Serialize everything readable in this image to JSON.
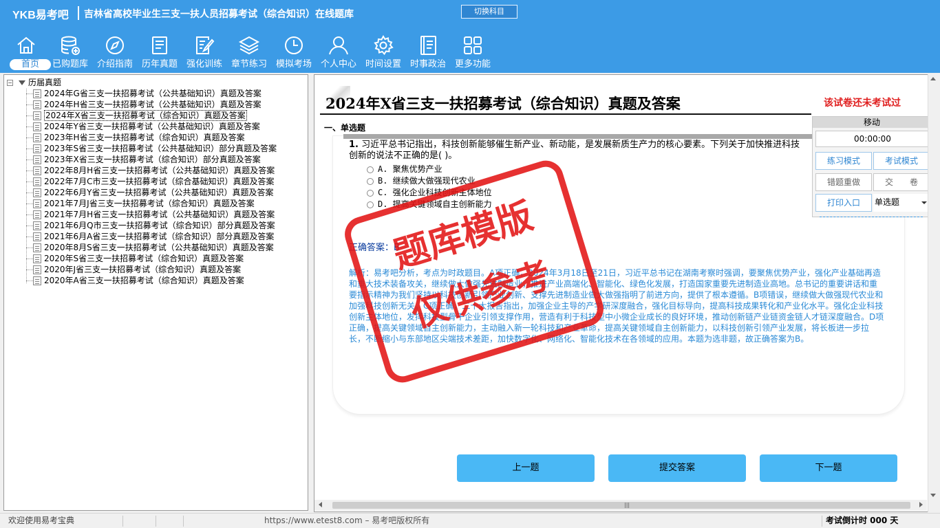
{
  "header": {
    "logo": "YKB易考吧",
    "title": "吉林省高校毕业生三支一扶人员招募考试（综合知识）在线题库",
    "switch_button": "切换科目"
  },
  "toolbar": {
    "items": [
      {
        "label": "首页",
        "icon": "home-icon"
      },
      {
        "label": "已购题库",
        "icon": "database-add-icon"
      },
      {
        "label": "介绍指南",
        "icon": "compass-icon"
      },
      {
        "label": "历年真题",
        "icon": "document-list-icon"
      },
      {
        "label": "强化训练",
        "icon": "edit-document-icon"
      },
      {
        "label": "章节练习",
        "icon": "layers-icon"
      },
      {
        "label": "模拟考场",
        "icon": "clock-icon"
      },
      {
        "label": "个人中心",
        "icon": "user-icon"
      },
      {
        "label": "时间设置",
        "icon": "gear-icon"
      },
      {
        "label": "时事政治",
        "icon": "notebook-icon"
      },
      {
        "label": "更多功能",
        "icon": "grid-icon"
      }
    ]
  },
  "tree": {
    "root": "历届真题",
    "items": [
      "2024年G省三支一扶招募考试（公共基础知识）真题及答案",
      "2024年H省三支一扶招募考试（公共基础知识）真题及答案",
      "2024年X省三支一扶招募考试（综合知识）真题及答案",
      "2024年Y省三支一扶招募考试（公共基础知识）真题及答案",
      "2023年H省三支一扶招募考试（综合知识）真题及答案",
      "2023年S省三支一扶招募考试（公共基础知识）部分真题及答案",
      "2023年X省三支一扶招募考试（综合知识）部分真题及答案",
      "2022年8月H省三支一扶招募考试（公共基础知识）真题及答案",
      "2022年7月C市三支一扶招募考试（综合基础知识）真题及答案",
      "2022年6月Y省三支一扶招募考试（公共基础知识）真题及答案",
      "2021年7月J省三支一扶招募考试（综合知识）真题及答案",
      "2021年7月H省三支一扶招募考试（公共基础知识）真题及答案",
      "2021年6月Q市三支一扶招募考试（综合知识）部分真题及答案",
      "2021年6月A省三支一扶招募考试（综合知识）部分真题及答案",
      "2020年8月S省三支一扶招募考试（公共基础知识）真题及答案",
      "2020年S省三支一扶招募考试（综合知识）真题及答案",
      "2020年J省三支一扶招募考试（综合知识）真题及答案",
      "2020年A省三支一扶招募考试（综合知识）真题及答案"
    ]
  },
  "paper": {
    "title": "2024年X省三支一扶招募考试（综合知识）真题及答案",
    "status": "该试卷还未考试过",
    "section": "一、单选题",
    "question_number": "1.",
    "question_text": "习近平总书记指出，科技创新能够催生新产业、新动能，是发展新质生产力的核心要素。下列关于加快推进科技创新的说法不正确的是(  )。",
    "options": [
      "A. 聚焦优势产业",
      "B. 继续做大做强现代农业",
      "C. 强化企业科技创新主体地位",
      "D. 提高关键领域自主创新能力"
    ],
    "answer_label": "正确答案：B",
    "analysis": "解析：易考吧分析，考点为时政题目。A项正确，2024年3月18日至21日，习近平总书记在湖南考察时强调，要聚焦优势产业，强化产业基础再造和重大技术装备攻关，继续做大做强先进制造业，推进产业高端化、智能化、绿色化发展，打造国家重要先进制造业高地。总书记的重要讲话和重要指示精神为我们坚持以科技创新引领产业创新、支撑先进制造业做大做强指明了前进方向，提供了根本遵循。B项错误，继续做大做强现代农业和加强科技创新无关。C项正确，二十大报告指出，加强企业主导的产学研深度融合，强化目标导向，提高科技成果转化和产业化水平。强化企业科技创新主体地位，发挥科技型骨干企业引领支撑作用，营造有利于科技型中小微企业成长的良好环境，推动创新链产业链资金链人才链深度融合。D项正确，提高关键领域自主创新能力，主动融入新一轮科技和产业革命，提高关键领域自主创新能力，以科技创新引领产业发展，将长板进一步拉长，不断缩小与东部地区尖端技术差距，加快数字化、网络化、智能化技术在各领域的应用。本题为选非题，故正确答案为B。"
  },
  "control_box": {
    "move": "移动",
    "timer": "00:00:00",
    "practice_mode": "练习模式",
    "exam_mode": "考试模式",
    "redo_wrong": "错题重做",
    "submit_paper": "交　　卷",
    "print": "打印入口",
    "question_type": "单选题"
  },
  "nav": {
    "prev": "上一题",
    "submit": "提交答案",
    "next": "下一题"
  },
  "watermark": {
    "line1": "题库模版",
    "line2": "仅供参考"
  },
  "statusbar": {
    "welcome": "欢迎使用易考宝典",
    "copyright": "https://www.etest8.com – 易考吧版权所有",
    "countdown": "考试倒计时 000 天"
  },
  "colors": {
    "header_bg": "#3c9be6",
    "status_red": "#e02020",
    "analysis_blue": "#2a8ad6",
    "nav_button": "#4ab8f5"
  }
}
